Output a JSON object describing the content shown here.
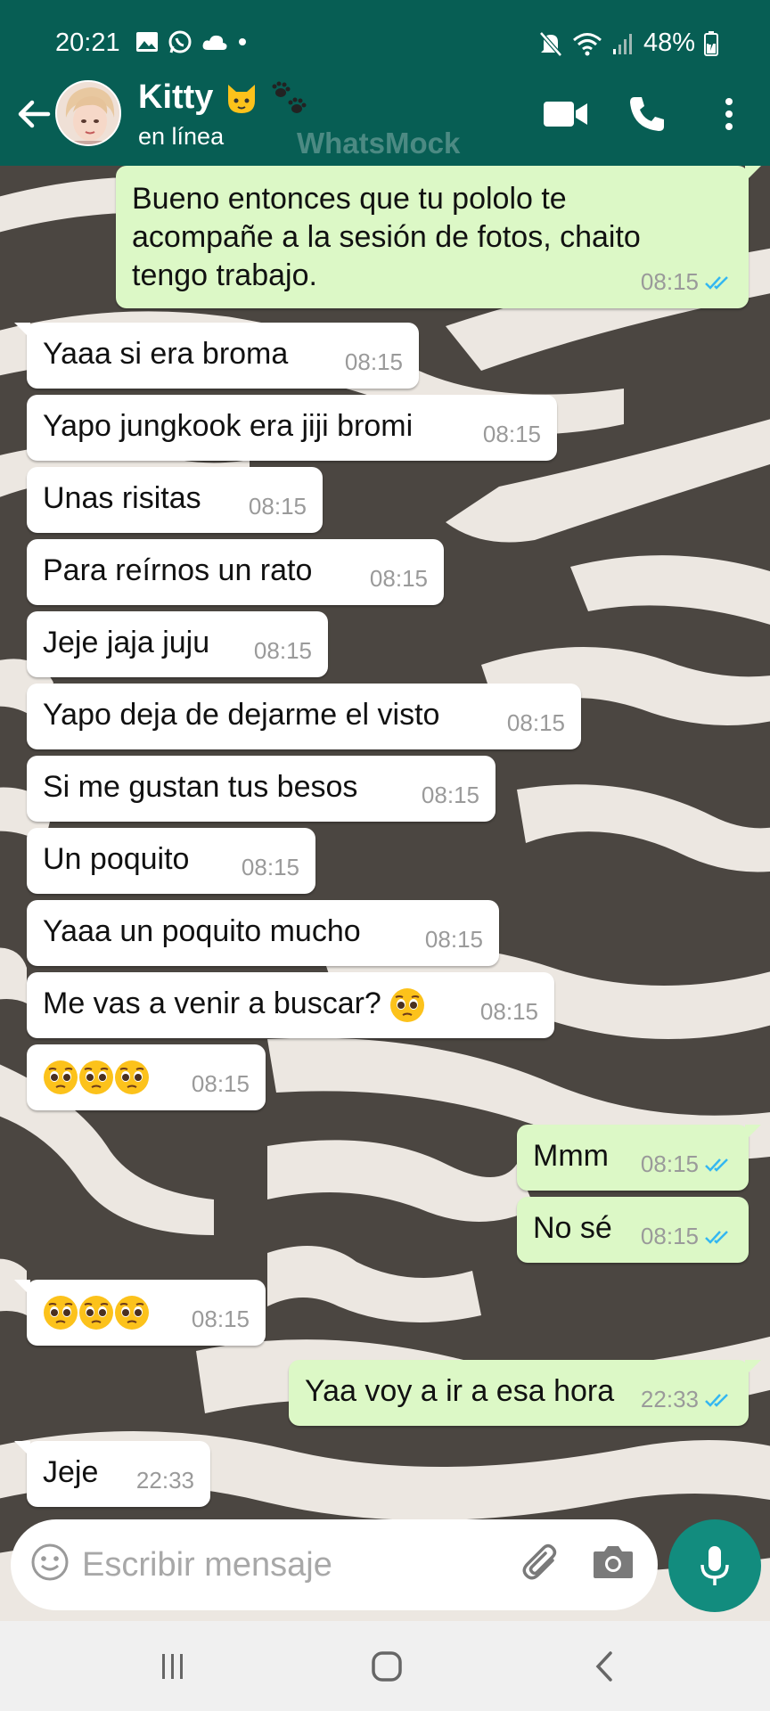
{
  "status_bar": {
    "time": "20:21",
    "battery": "48%",
    "icons": [
      "gallery-icon",
      "whatsapp-icon",
      "cloud-icon",
      "dot-icon",
      "mute-icon",
      "wifi-icon",
      "signal-icon",
      "battery-icon"
    ]
  },
  "header": {
    "contact_name": "Kitty",
    "status": "en línea",
    "watermark": "WhatsMock",
    "name_emoji": [
      "cat-face-emoji",
      "paw-prints-emoji"
    ],
    "colors": {
      "bar": "#075e54",
      "accent": "#128c7e"
    }
  },
  "messages": [
    {
      "dir": "out",
      "text": "Bueno entonces que tu pololo te acompañe a la sesión de fotos, chaito tengo trabajo.",
      "time": "08:15",
      "read": true
    },
    {
      "dir": "in",
      "text": "Yaaa si era broma",
      "time": "08:15"
    },
    {
      "dir": "in",
      "text": "Yapo jungkook era jiji bromi",
      "time": "08:15"
    },
    {
      "dir": "in",
      "text": "Unas risitas",
      "time": "08:15"
    },
    {
      "dir": "in",
      "text": "Para reírnos un rato",
      "time": "08:15"
    },
    {
      "dir": "in",
      "text": "Jeje jaja juju",
      "time": "08:15"
    },
    {
      "dir": "in",
      "text": "Yapo deja de dejarme el visto",
      "time": "08:15"
    },
    {
      "dir": "in",
      "text": "Si me gustan tus besos",
      "time": "08:15"
    },
    {
      "dir": "in",
      "text": "Un poquito",
      "time": "08:15"
    },
    {
      "dir": "in",
      "text": "Yaaa un poquito mucho",
      "time": "08:15"
    },
    {
      "dir": "in",
      "text": "Me vas a venir a buscar?",
      "time": "08:15",
      "emoji": [
        "pleading-face"
      ]
    },
    {
      "dir": "in",
      "text": "",
      "time": "08:15",
      "emoji": [
        "pleading-face",
        "pleading-face",
        "pleading-face"
      ]
    },
    {
      "dir": "out",
      "text": "Mmm",
      "time": "08:15",
      "read": true
    },
    {
      "dir": "out",
      "text": "No sé",
      "time": "08:15",
      "read": true
    },
    {
      "dir": "in",
      "text": "",
      "time": "08:15",
      "emoji": [
        "pleading-face",
        "pleading-face",
        "pleading-face"
      ]
    },
    {
      "dir": "out",
      "text": "Yaa voy a ir a esa hora",
      "time": "22:33",
      "read": true
    },
    {
      "dir": "in",
      "text": "Jeje",
      "time": "22:33"
    }
  ],
  "input": {
    "placeholder": "Escribir mensaje"
  },
  "nav": {
    "buttons": [
      "recents-icon",
      "home-icon",
      "back-icon"
    ]
  }
}
